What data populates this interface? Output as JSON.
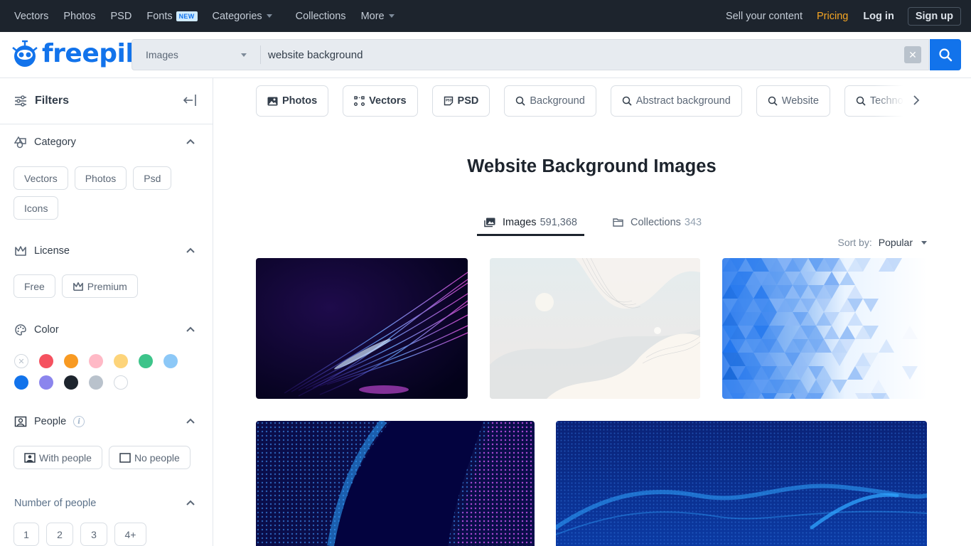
{
  "topnav": {
    "items": [
      {
        "label": "Vectors"
      },
      {
        "label": "Photos"
      },
      {
        "label": "PSD"
      },
      {
        "label": "Fonts",
        "badge": "NEW"
      },
      {
        "label": "Categories",
        "dropdown": true
      },
      {
        "label": "Collections"
      },
      {
        "label": "More",
        "dropdown": true
      }
    ],
    "sell": "Sell your content",
    "pricing": "Pricing",
    "login": "Log in",
    "signup": "Sign up"
  },
  "brand": {
    "name": "freepik",
    "color": "#1273eb"
  },
  "search": {
    "type_selected": "Images",
    "query": "website background",
    "clear_icon": "close-icon",
    "submit_icon": "search-icon"
  },
  "sidebar": {
    "title": "Filters",
    "category": {
      "title": "Category",
      "options": [
        "Vectors",
        "Photos",
        "Psd",
        "Icons"
      ]
    },
    "license": {
      "title": "License",
      "options": [
        "Free",
        "Premium"
      ]
    },
    "color": {
      "title": "Color",
      "swatches": [
        "none",
        "#f5515f",
        "#f89a22",
        "#ffb9c6",
        "#fdd47a",
        "#3dc48a",
        "#8cc8f7",
        "#1273eb",
        "#8b85ed",
        "#1d242d",
        "#b9c2cc",
        "#ffffff"
      ]
    },
    "people": {
      "title": "People",
      "options": [
        "With people",
        "No people"
      ]
    },
    "number_of_people": {
      "title": "Number of people",
      "options": [
        "1",
        "2",
        "3",
        "4+"
      ]
    }
  },
  "related": [
    {
      "label": "Photos",
      "icon": "image-icon",
      "bold": true
    },
    {
      "label": "Vectors",
      "icon": "vector-icon",
      "bold": true
    },
    {
      "label": "PSD",
      "icon": "psd-icon",
      "bold": true
    },
    {
      "label": "Background",
      "icon": "search-icon"
    },
    {
      "label": "Abstract background",
      "icon": "search-icon"
    },
    {
      "label": "Website",
      "icon": "search-icon"
    },
    {
      "label": "Technology",
      "icon": "search-icon"
    }
  ],
  "main": {
    "title": "Website Background Images",
    "tabs": [
      {
        "label": "Images",
        "count": "591,368",
        "active": true
      },
      {
        "label": "Collections",
        "count": "343",
        "active": false
      }
    ],
    "sort": {
      "label": "Sort by:",
      "value": "Popular"
    }
  },
  "results": [
    {
      "description": "Dark purple abstract light streaks"
    },
    {
      "description": "Light pastel fluid wave shapes"
    },
    {
      "description": "Blue geometric triangle mosaic fading to white"
    },
    {
      "description": "Blue and pink dotted wave on dark navy"
    },
    {
      "description": "Blue particle dot wave on navy"
    }
  ]
}
